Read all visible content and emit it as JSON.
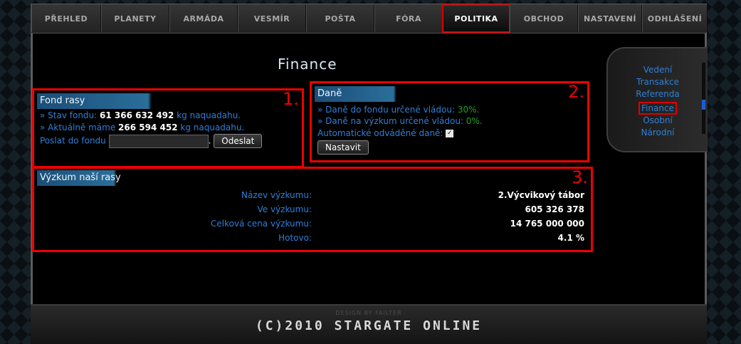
{
  "nav": {
    "tabs": [
      {
        "label": "PŘEHLED"
      },
      {
        "label": "PLANETY"
      },
      {
        "label": "ARMÁDA"
      },
      {
        "label": "VESMÍR"
      },
      {
        "label": "POŠTA"
      },
      {
        "label": "FÓRA"
      },
      {
        "label": "POLITIKA"
      },
      {
        "label": "OBCHOD"
      },
      {
        "label": "NASTAVENÍ"
      },
      {
        "label": "ODHLÁŠENÍ"
      }
    ],
    "active": "POLITIKA"
  },
  "page": {
    "title": "Finance"
  },
  "sidemenu": {
    "items": [
      {
        "label": "Vedení"
      },
      {
        "label": "Transakce"
      },
      {
        "label": "Referenda"
      },
      {
        "label": "Finance"
      },
      {
        "label": "Osobní"
      },
      {
        "label": "Národní"
      }
    ],
    "active": "Finance"
  },
  "fond": {
    "number": "1.",
    "header": "Fond rasy",
    "stav_prefix": "» Stav fondu: ",
    "stav_value": "61 366 632 492",
    "stav_suffix": " kg naquadahu.",
    "aktualne_prefix": "» Aktuálně máme ",
    "aktualne_value": "266 594 452",
    "aktualne_suffix": " kg naquadahu.",
    "poslat_label": "Poslat do fondu",
    "poslat_value": "",
    "dot": ".",
    "send_button": "Odeslat"
  },
  "dane": {
    "number": "2.",
    "header": "Daně",
    "fond_label": "» Daně do fondu určené vládou: ",
    "fond_value": "30%",
    "fond_end": ".",
    "vyzkum_label": "» Daně na výzkum určené vládou: ",
    "vyzkum_value": "0%",
    "vyzkum_end": ".",
    "auto_label": "Automatické odváděné daně:",
    "auto_checked": true,
    "set_button": "Nastavit"
  },
  "vyzkum": {
    "number": "3.",
    "header": "Výzkum naší rasy",
    "rows": [
      {
        "label": "Název výzkumu:",
        "value": "2.Výcvikový tábor"
      },
      {
        "label": "Ve výzkumu:",
        "value": "605 326 378"
      },
      {
        "label": "Celková cena výzkumu:",
        "value": "14 765 000 000"
      },
      {
        "label": "Hotovo:",
        "value": "4.1 %"
      }
    ]
  },
  "footer": {
    "design_by": "DESIGN BY FAILTER",
    "copyright": "(C)2010 STARGATE ONLINE"
  }
}
